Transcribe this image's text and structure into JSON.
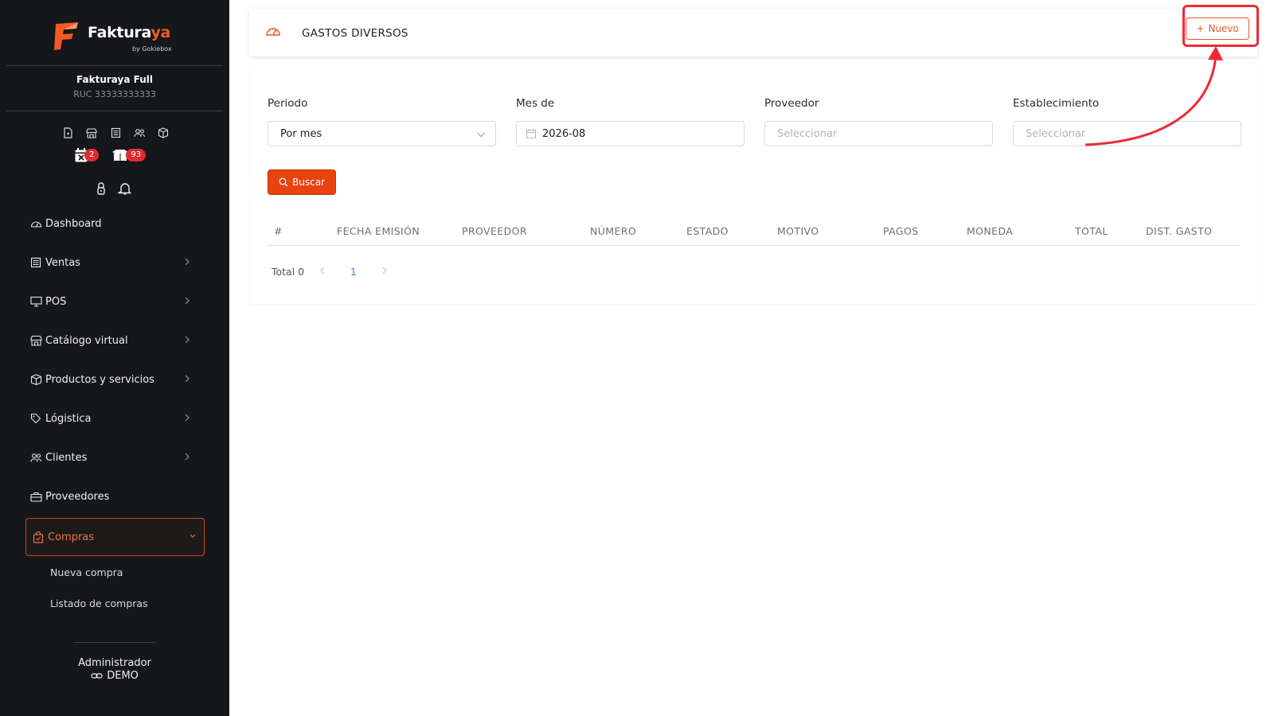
{
  "brand": {
    "name_main": "Faktura",
    "name_accent": "ya",
    "sub": "by Gokiebox",
    "accent_color": "#f15a22"
  },
  "company": {
    "name": "Fakturaya Full",
    "ruc": "RUC 33333333333"
  },
  "notifications": {
    "calendar_count": "2",
    "box_count": "93"
  },
  "sidebar": {
    "items": [
      {
        "label": "Dashboard"
      },
      {
        "label": "Ventas"
      },
      {
        "label": "POS"
      },
      {
        "label": "Catálogo virtual"
      },
      {
        "label": "Productos y servicios"
      },
      {
        "label": "Lógistica"
      },
      {
        "label": "Clientes"
      },
      {
        "label": "Proveedores"
      },
      {
        "label": "Compras"
      }
    ],
    "submenu": [
      {
        "label": "Nueva compra"
      },
      {
        "label": "Listado de compras"
      }
    ]
  },
  "user": {
    "role": "Administrador",
    "name": "DEMO"
  },
  "header": {
    "title": "GASTOS DIVERSOS",
    "new_button": "Nuevo"
  },
  "filters": {
    "periodo": {
      "label": "Periodo",
      "value": "Por mes"
    },
    "mes": {
      "label": "Mes de",
      "value": "2026-08"
    },
    "proveedor": {
      "label": "Proveedor",
      "placeholder": "Seleccionar"
    },
    "establecimiento": {
      "label": "Establecimiento",
      "placeholder": "Seleccionar"
    },
    "search_button": "Buscar"
  },
  "table": {
    "columns": [
      "#",
      "FECHA EMISIÓN",
      "PROVEEDOR",
      "NÚMERO",
      "ESTADO",
      "MOTIVO",
      "PAGOS",
      "MONEDA",
      "TOTAL",
      "DIST. GASTO"
    ],
    "rows": []
  },
  "pagination": {
    "total_label": "Total 0",
    "current_page": "1"
  },
  "colors": {
    "sidebar_bg": "#15171b",
    "primary": "#e8420f",
    "highlight": "#ee2a35",
    "link": "#2d8cf0"
  }
}
